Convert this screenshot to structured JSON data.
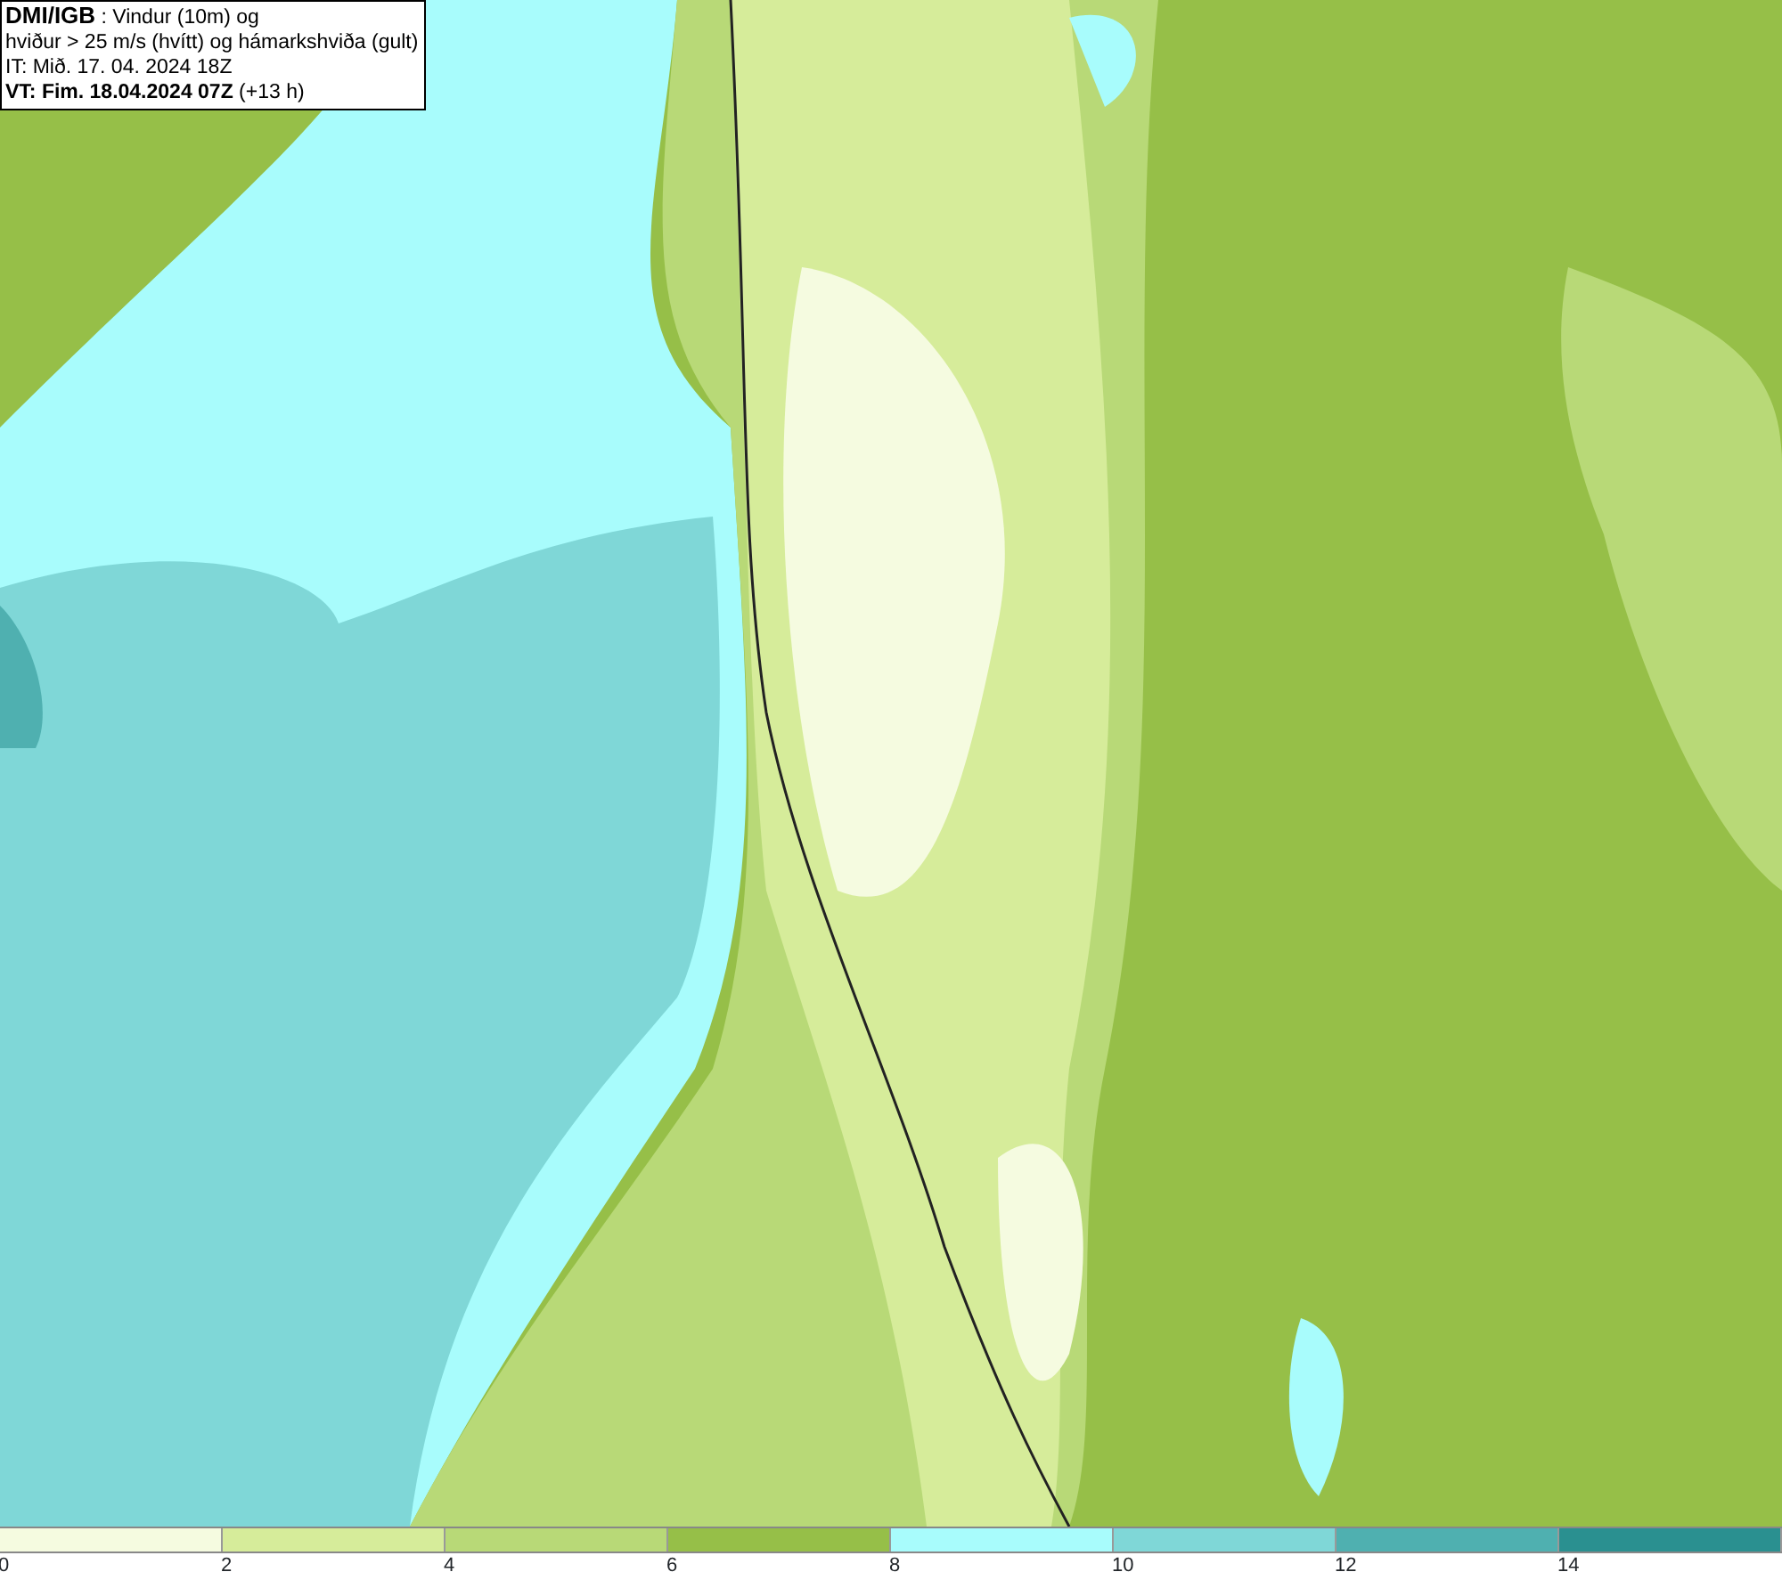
{
  "legend": {
    "lines": [
      {
        "kind": "title",
        "text": "**DMI/IGB** : Vindur (10m) og"
      },
      {
        "kind": "plain",
        "text": "hviður > 25 m/s (hvítt) og hámarkshviða (gult)"
      },
      {
        "kind": "plain",
        "text": "IT: Mið. 17. 04. 2024 18Z"
      },
      {
        "kind": "plain",
        "text": "**VT: Fim. 18.04.2024 07Z** (+13 h)"
      }
    ]
  },
  "colorbar": {
    "segments": [
      {
        "color": "#f5fbe0"
      },
      {
        "color": "#d6ec9a"
      },
      {
        "color": "#b8d977"
      },
      {
        "color": "#96bf48"
      },
      {
        "color": "#a8fcfc"
      },
      {
        "color": "#7fd7d7"
      },
      {
        "color": "#4fb0b0"
      },
      {
        "color": "#2a9090"
      }
    ],
    "ticks": [
      "0",
      "2",
      "4",
      "6",
      "8",
      "10",
      "12",
      "14"
    ]
  }
}
